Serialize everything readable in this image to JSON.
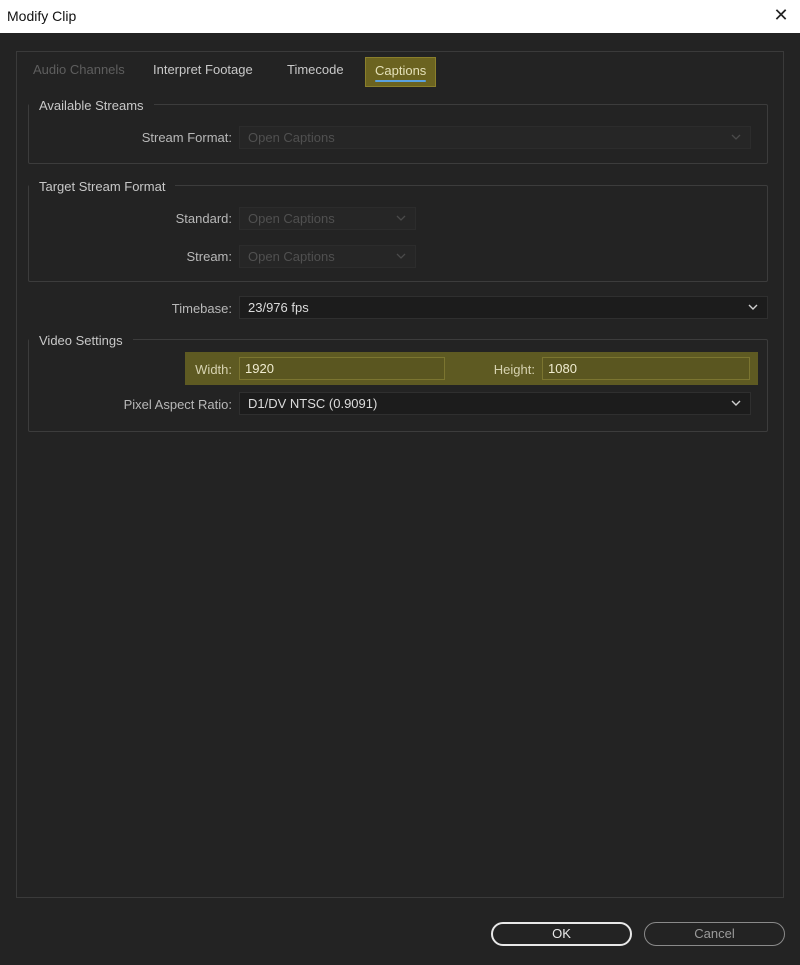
{
  "window": {
    "title": "Modify Clip",
    "close_icon": "close-icon"
  },
  "tabs": [
    {
      "label": "Audio Channels",
      "state": "disabled"
    },
    {
      "label": "Interpret Footage",
      "state": "normal"
    },
    {
      "label": "Timecode",
      "state": "normal"
    },
    {
      "label": "Captions",
      "state": "selected"
    }
  ],
  "available_streams": {
    "legend": "Available Streams",
    "stream_format_label": "Stream Format:",
    "stream_format_value": "Open Captions"
  },
  "target_stream_format": {
    "legend": "Target Stream Format",
    "standard_label": "Standard:",
    "standard_value": "Open Captions",
    "stream_label": "Stream:",
    "stream_value": "Open Captions"
  },
  "timebase": {
    "label": "Timebase:",
    "value": "23/976 fps"
  },
  "video_settings": {
    "legend": "Video Settings",
    "width_label": "Width:",
    "width_value": "1920",
    "height_label": "Height:",
    "height_value": "1080",
    "par_label": "Pixel Aspect Ratio:",
    "par_value": "D1/DV NTSC (0.9091)"
  },
  "buttons": {
    "ok": "OK",
    "cancel": "Cancel"
  },
  "colors": {
    "highlight": "#5e5a22",
    "tab_selected": "#6b6320",
    "tab_underline": "#5aa2e0"
  }
}
